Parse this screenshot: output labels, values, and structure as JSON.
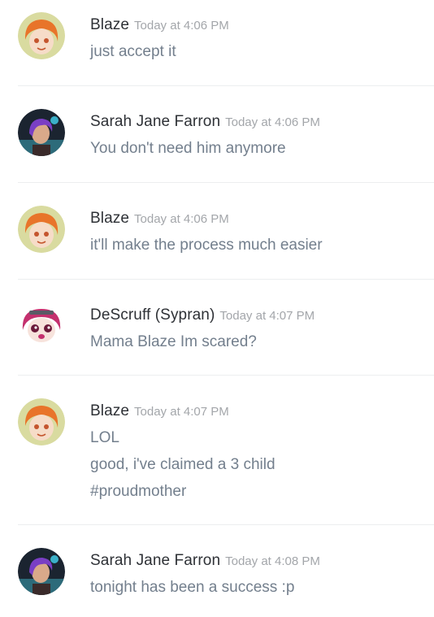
{
  "messages": [
    {
      "username": "Blaze",
      "timestamp": "Today at 4:06 PM",
      "lines": [
        "just accept it"
      ],
      "avatar": "orange-hair-avatar-icon"
    },
    {
      "username": "Sarah Jane Farron",
      "timestamp": "Today at 4:06 PM",
      "lines": [
        "You don't need him anymore"
      ],
      "avatar": "purple-hair-avatar-icon"
    },
    {
      "username": "Blaze",
      "timestamp": "Today at 4:06 PM",
      "lines": [
        "it'll make the process much easier"
      ],
      "avatar": "orange-hair-avatar-icon"
    },
    {
      "username": "DeScruff (Sypran)",
      "timestamp": "Today at 4:07 PM",
      "lines": [
        "Mama Blaze Im scared?"
      ],
      "avatar": "magenta-hair-avatar-icon"
    },
    {
      "username": "Blaze",
      "timestamp": "Today at 4:07 PM",
      "lines": [
        "LOL",
        "good, i've claimed a 3 child",
        "#proudmother"
      ],
      "avatar": "orange-hair-avatar-icon"
    },
    {
      "username": "Sarah Jane Farron",
      "timestamp": "Today at 4:08 PM",
      "lines": [
        "tonight has been a success :p"
      ],
      "avatar": "purple-hair-avatar-icon"
    }
  ],
  "colors": {
    "username": "#2e3136",
    "timestamp": "#a3a6aa",
    "message_text": "#737f8d",
    "divider": "#eceeef"
  }
}
